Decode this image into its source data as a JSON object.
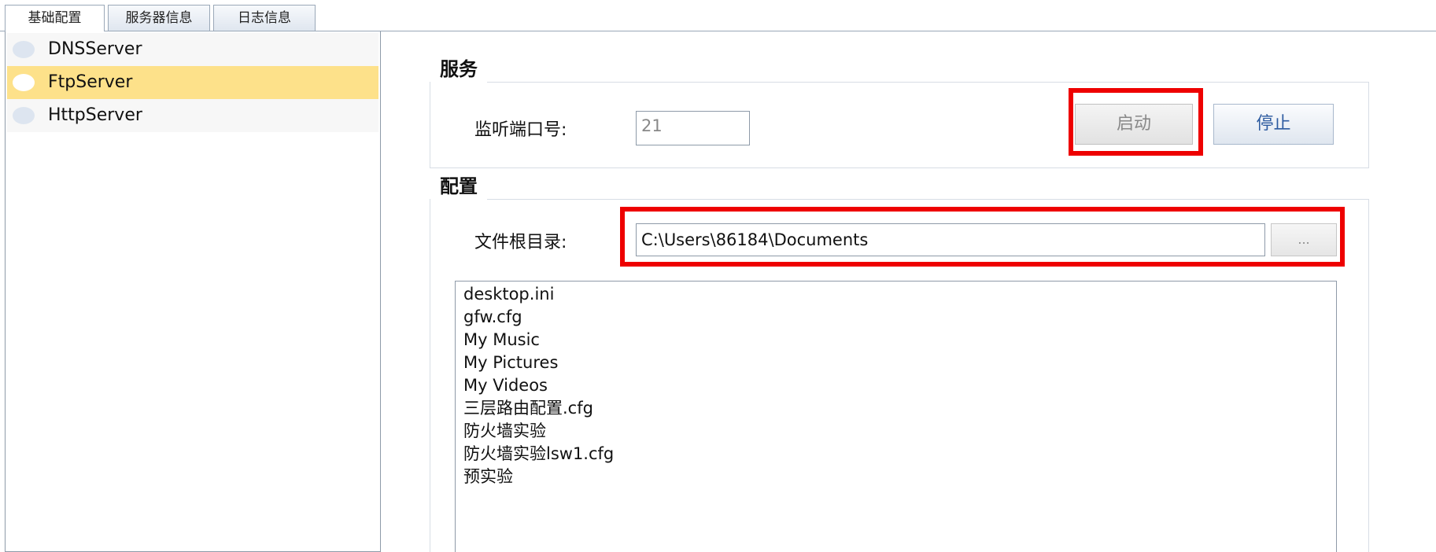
{
  "tabs": [
    {
      "label": "基础配置",
      "active": true
    },
    {
      "label": "服务器信息",
      "active": false
    },
    {
      "label": "日志信息",
      "active": false
    }
  ],
  "servers": [
    {
      "label": "DNSServer",
      "selected": false
    },
    {
      "label": "FtpServer",
      "selected": true
    },
    {
      "label": "HttpServer",
      "selected": false
    }
  ],
  "service": {
    "title": "服务",
    "port_label": "监听端口号:",
    "port_value": "21",
    "start_label": "启动",
    "stop_label": "停止"
  },
  "config": {
    "title": "配置",
    "root_label": "文件根目录:",
    "root_value": "C:\\Users\\86184\\Documents",
    "browse_label": "..."
  },
  "files": [
    "desktop.ini",
    "gfw.cfg",
    "My Music",
    "My Pictures",
    "My Videos",
    "三层路由配置.cfg",
    "防火墙实验",
    "防火墙实验lsw1.cfg",
    "预实验"
  ],
  "colors": {
    "selected_row": "#fde18a",
    "highlight": "#ee0000",
    "stop_text": "#2c5aa0"
  }
}
